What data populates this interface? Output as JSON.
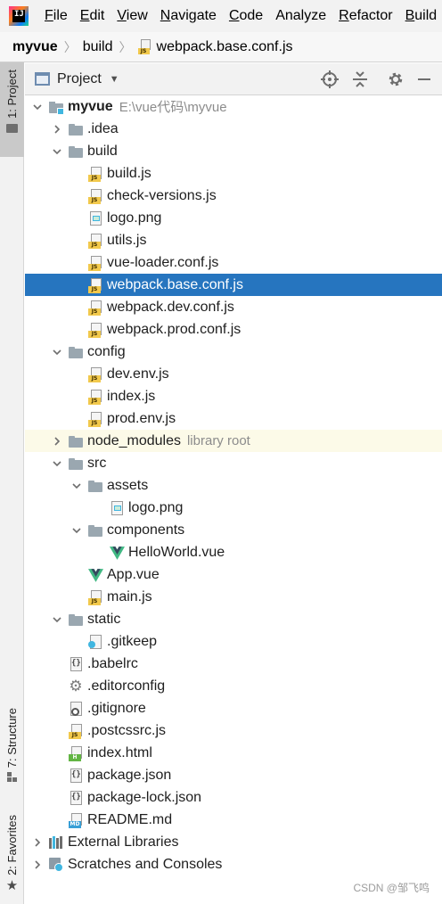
{
  "app": {
    "logo_glyph": "IJ"
  },
  "menu": [
    {
      "first": "F",
      "rest": "ile"
    },
    {
      "first": "E",
      "rest": "dit"
    },
    {
      "first": "V",
      "rest": "iew"
    },
    {
      "first": "N",
      "rest": "avigate"
    },
    {
      "first": "C",
      "rest": "ode"
    },
    {
      "first": "",
      "rest": "Analyze"
    },
    {
      "first": "R",
      "rest": "efactor"
    },
    {
      "first": "B",
      "rest": "uild"
    }
  ],
  "breadcrumb": {
    "project": "myvue",
    "folder": "build",
    "file": "webpack.base.conf.js",
    "separator": "〉"
  },
  "stripe": {
    "project": "1: Project",
    "structure": "7: Structure",
    "favorites": "2: Favorites",
    "favorites_glyph": "★"
  },
  "toolbar": {
    "title": "Project",
    "caret": "▼",
    "locate_glyph": "⊕",
    "collapse_glyph": "≑",
    "settings_glyph": "⚙",
    "hide_glyph": "—"
  },
  "tree": [
    {
      "label": "myvue",
      "hint": "E:\\vue代码\\myvue",
      "icon": "module",
      "depth": 0,
      "chevron": "down",
      "bold": true
    },
    {
      "label": ".idea",
      "icon": "folder",
      "depth": 1,
      "chevron": "right"
    },
    {
      "label": "build",
      "icon": "folder",
      "depth": 1,
      "chevron": "down"
    },
    {
      "label": "build.js",
      "icon": "js",
      "depth": 2
    },
    {
      "label": "check-versions.js",
      "icon": "js",
      "depth": 2
    },
    {
      "label": "logo.png",
      "icon": "img",
      "depth": 2
    },
    {
      "label": "utils.js",
      "icon": "js",
      "depth": 2
    },
    {
      "label": "vue-loader.conf.js",
      "icon": "js",
      "depth": 2
    },
    {
      "label": "webpack.base.conf.js",
      "icon": "js",
      "depth": 2,
      "selected": true
    },
    {
      "label": "webpack.dev.conf.js",
      "icon": "js",
      "depth": 2
    },
    {
      "label": "webpack.prod.conf.js",
      "icon": "js",
      "depth": 2
    },
    {
      "label": "config",
      "icon": "folder",
      "depth": 1,
      "chevron": "down"
    },
    {
      "label": "dev.env.js",
      "icon": "js",
      "depth": 2
    },
    {
      "label": "index.js",
      "icon": "js",
      "depth": 2
    },
    {
      "label": "prod.env.js",
      "icon": "js",
      "depth": 2
    },
    {
      "label": "node_modules",
      "hint": "library root",
      "icon": "folder",
      "depth": 1,
      "chevron": "right",
      "library": true
    },
    {
      "label": "src",
      "icon": "folder",
      "depth": 1,
      "chevron": "down"
    },
    {
      "label": "assets",
      "icon": "folder",
      "depth": 2,
      "chevron": "down"
    },
    {
      "label": "logo.png",
      "icon": "img",
      "depth": 3
    },
    {
      "label": "components",
      "icon": "folder",
      "depth": 2,
      "chevron": "down"
    },
    {
      "label": "HelloWorld.vue",
      "icon": "vue",
      "depth": 3
    },
    {
      "label": "App.vue",
      "icon": "vue",
      "depth": 2
    },
    {
      "label": "main.js",
      "icon": "js",
      "depth": 2
    },
    {
      "label": "static",
      "icon": "folder",
      "depth": 1,
      "chevron": "down"
    },
    {
      "label": ".gitkeep",
      "icon": "keep",
      "depth": 2
    },
    {
      "label": ".babelrc",
      "icon": "json",
      "depth": 1
    },
    {
      "label": ".editorconfig",
      "icon": "gear",
      "depth": 1
    },
    {
      "label": ".gitignore",
      "icon": "ignore",
      "depth": 1
    },
    {
      "label": ".postcssrc.js",
      "icon": "js",
      "depth": 1
    },
    {
      "label": "index.html",
      "icon": "html",
      "depth": 1
    },
    {
      "label": "package.json",
      "icon": "json",
      "depth": 1
    },
    {
      "label": "package-lock.json",
      "icon": "json",
      "depth": 1
    },
    {
      "label": "README.md",
      "icon": "md",
      "depth": 1
    },
    {
      "label": "External Libraries",
      "icon": "libs",
      "depth": 0,
      "chevron": "right"
    },
    {
      "label": "Scratches and Consoles",
      "icon": "scratch",
      "depth": 0,
      "chevron": "right"
    }
  ],
  "watermark": "CSDN @邹飞鸣",
  "colors": {
    "selection": "#2675bf",
    "library_bg": "#fcfae8",
    "vue_green": "#41b883",
    "vue_dark": "#35495e"
  }
}
